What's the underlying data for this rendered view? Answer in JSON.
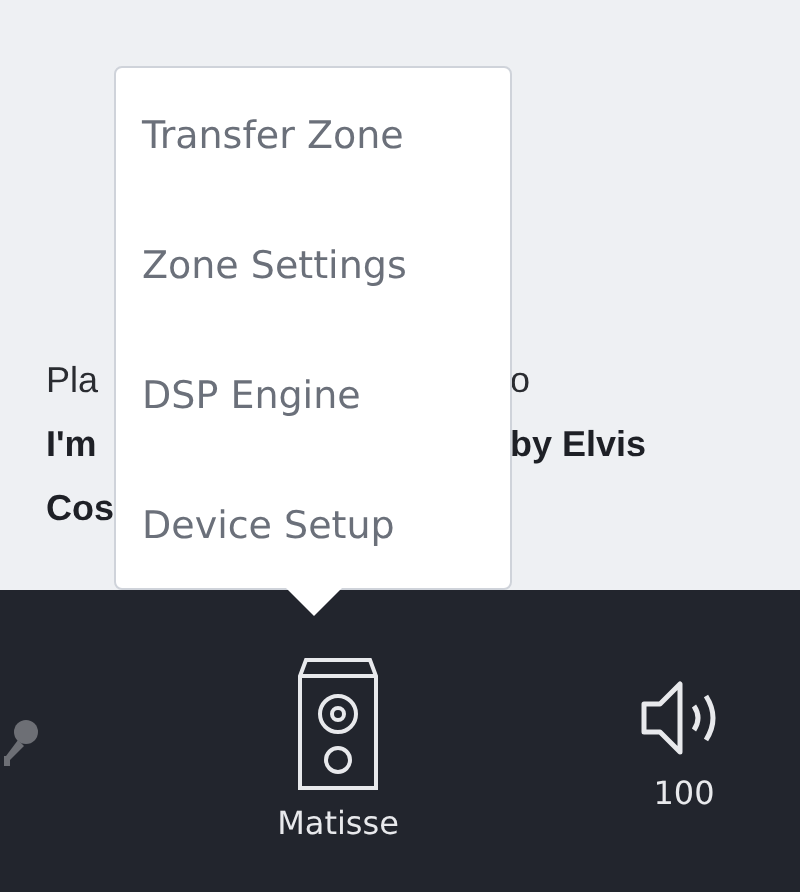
{
  "now_playing": {
    "lines": [
      {
        "kind": "label",
        "left": "Pla",
        "right": "o"
      },
      {
        "kind": "title",
        "left": "I'm",
        "right": "by Elvis"
      },
      {
        "kind": "title",
        "left": "Cos"
      }
    ]
  },
  "menu": {
    "items": [
      {
        "label": "Transfer Zone"
      },
      {
        "label": "Zone Settings"
      },
      {
        "label": "DSP Engine"
      },
      {
        "label": "Device Setup"
      }
    ]
  },
  "bar": {
    "zone": "Matisse",
    "volume": "100"
  }
}
